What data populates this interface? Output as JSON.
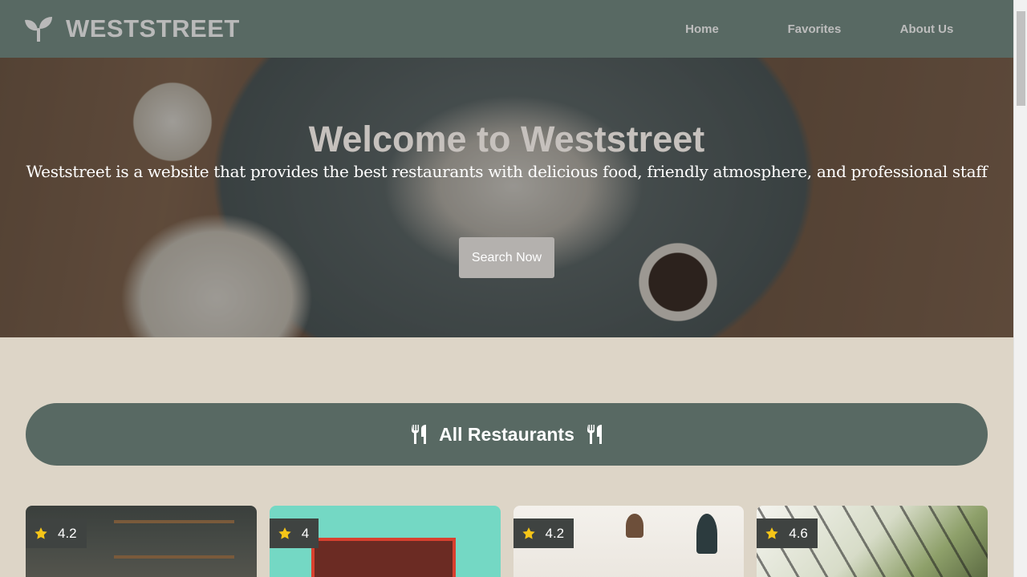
{
  "header": {
    "brand": "WESTSTREET",
    "logo_icon": "seedling-icon",
    "nav": [
      {
        "label": "Home"
      },
      {
        "label": "Favorites"
      },
      {
        "label": "About Us"
      }
    ]
  },
  "hero": {
    "title": "Welcome to Weststreet",
    "subtitle": "Weststreet is a website that provides the best restaurants with delicious food, friendly atmosphere, and professional staff",
    "button_label": "Search Now"
  },
  "section": {
    "title": "All Restaurants",
    "icon": "utensils-icon"
  },
  "restaurants": [
    {
      "rating": "4.2"
    },
    {
      "rating": "4"
    },
    {
      "rating": "4.2"
    },
    {
      "rating": "4.6"
    }
  ],
  "colors": {
    "primary": "#586963",
    "background": "#ddd5c7",
    "star": "#f5c518",
    "rating_badge": "#3f4341"
  }
}
